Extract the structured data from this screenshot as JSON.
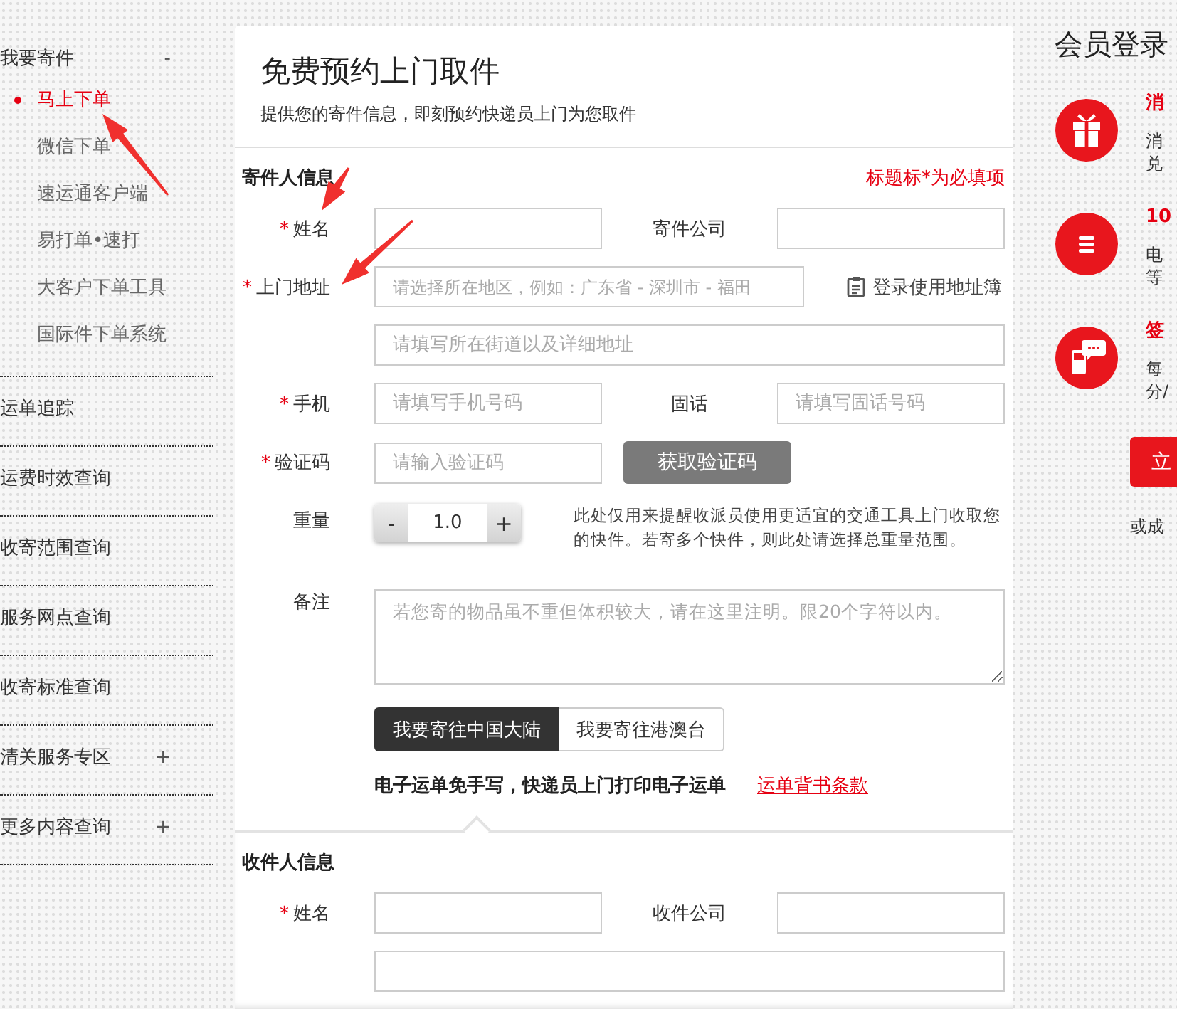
{
  "sidebar": {
    "items": [
      {
        "label": "我要寄件",
        "toggle": "-",
        "children": [
          {
            "label": "马上下单",
            "selected": true
          },
          {
            "label": "微信下单",
            "selected": false
          },
          {
            "label": "速运通客户端",
            "selected": false
          },
          {
            "label": "易打单•速打",
            "selected": false
          },
          {
            "label": "大客户下单工具",
            "selected": false
          },
          {
            "label": "国际件下单系统",
            "selected": false
          }
        ]
      },
      {
        "label": "运单追踪"
      },
      {
        "label": "运费时效查询"
      },
      {
        "label": "收寄范围查询"
      },
      {
        "label": "服务网点查询"
      },
      {
        "label": "收寄标准查询"
      },
      {
        "label": "清关服务专区",
        "toggle": "+"
      },
      {
        "label": "更多内容查询",
        "toggle": "+"
      }
    ]
  },
  "form": {
    "title": "免费预约上门取件",
    "subtitle": "提供您的寄件信息，即刻预约快递员上门为您取件",
    "sections": [
      {
        "heading": "寄件人信息",
        "required_note": "标题标*为必填项",
        "rows": [
          {
            "kind": "pair",
            "label": "姓名",
            "required_mark": "*",
            "label2": "寄件公司"
          },
          {
            "kind": "address",
            "label": "上门地址",
            "required_mark": "*",
            "placeholder": "请选择所在地区，例如：广东省 - 深圳市 - 福田",
            "link": "登录使用地址簿"
          },
          {
            "kind": "full",
            "placeholder": "请填写所在街道以及详细地址"
          },
          {
            "kind": "pair",
            "label": "手机",
            "required_mark": "*",
            "placeholder": "请填写手机号码",
            "label2": "固话",
            "placeholder2": "请填写固话号码"
          },
          {
            "kind": "captcha",
            "label": "验证码",
            "required_mark": "*",
            "placeholder": "请输入验证码",
            "button": "获取验证码"
          },
          {
            "kind": "stepper",
            "label": "重量",
            "minus": "-",
            "value": "1.0",
            "plus": "+",
            "hint": "此处仅用来提醒收派员使用更适宜的交通工具上门收取您的快件。若寄多个快件，则此处请选择总重量范围。"
          },
          {
            "kind": "textarea",
            "label": "备注",
            "placeholder": "若您寄的物品虽不重但体积较大，请在这里注明。限20个字符以内。"
          },
          {
            "kind": "toggle",
            "options": [
              {
                "label": "我要寄往中国大陆",
                "selected": true
              },
              {
                "label": "我要寄往港澳台",
                "selected": false
              }
            ]
          },
          {
            "kind": "note",
            "text": "电子运单免手写，快递员上门打印电子运单",
            "link": "运单背书条款"
          }
        ]
      },
      {
        "heading": "收件人信息",
        "rows": [
          {
            "kind": "pair",
            "label": "姓名",
            "required_mark": "*",
            "label2": "收件公司"
          },
          {
            "kind": "full"
          }
        ]
      }
    ]
  },
  "member": {
    "title": "会员登录",
    "benefits": [
      {
        "kind": "gift",
        "title": "消",
        "lines": [
          "消",
          "兑"
        ]
      },
      {
        "kind": "list",
        "title": "10",
        "lines": [
          "电",
          "等"
        ]
      },
      {
        "kind": "phone",
        "title": "签",
        "lines": [
          "每",
          "分/"
        ]
      }
    ],
    "button": "立",
    "footer": "或成"
  }
}
